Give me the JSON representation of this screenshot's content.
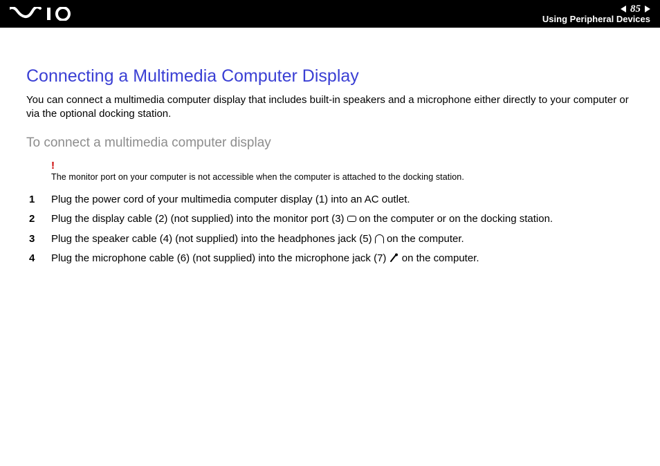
{
  "header": {
    "page_number": "85",
    "section": "Using Peripheral Devices"
  },
  "page": {
    "title": "Connecting a Multimedia Computer Display",
    "intro": "You can connect a multimedia computer display that includes built-in speakers and a microphone either directly to your computer or via the optional docking station.",
    "subhead": "To connect a multimedia computer display",
    "warning": "The monitor port on your computer is not accessible when the computer is attached to the docking station.",
    "steps": {
      "s1": "Plug the power cord of your multimedia computer display (1) into an AC outlet.",
      "s2a": "Plug the display cable (2) (not supplied) into the monitor port (3) ",
      "s2b": " on the computer or on the docking station.",
      "s3a": "Plug the speaker cable (4) (not supplied) into the headphones jack (5) ",
      "s3b": " on the computer.",
      "s4a": "Plug the microphone cable (6) (not supplied) into the microphone jack (7) ",
      "s4b": " on the computer."
    }
  }
}
